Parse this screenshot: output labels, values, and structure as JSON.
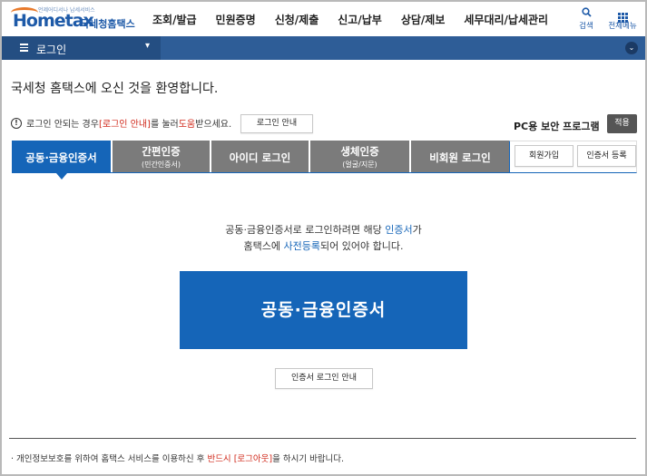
{
  "header": {
    "logo_sub": "언제어디서나 납세서비스",
    "logo_main": "Hometax",
    "logo_name": "국세청홈택스",
    "menu": [
      "조회/발급",
      "민원증명",
      "신청/제출",
      "신고/납부",
      "상담/제보",
      "세무대리/납세관리"
    ],
    "search_label": "검색",
    "all_menu_label": "전체메뉴"
  },
  "navbar": {
    "title": "로그인"
  },
  "welcome": "국세청 홈택스에 오신 것을 환영합니다.",
  "notice": {
    "prefix": "로그인 안되는 경우 ",
    "highlight": "[로그인 안내]",
    "middle": "를 눌러 ",
    "highlight2": "도움",
    "suffix": "받으세요.",
    "button": "로그인 안내"
  },
  "security": {
    "label": "PC용 보안 프로그램",
    "button": "적용"
  },
  "tabs": [
    {
      "label": "공동·금융인증서",
      "sub": ""
    },
    {
      "label": "간편인증",
      "sub": "(민간인증서)"
    },
    {
      "label": "아이디 로그인",
      "sub": ""
    },
    {
      "label": "생체인증",
      "sub": "(얼굴/지문)"
    },
    {
      "label": "비회원 로그인",
      "sub": ""
    }
  ],
  "side_buttons": {
    "join": "회원가입",
    "register": "인증서 등록"
  },
  "description": {
    "line1_a": "공동·금융인증서로 로그인하려면 해당 ",
    "line1_b": "인증서",
    "line1_c": "가",
    "line2_a": "홈택스에 ",
    "line2_b": "사전등록",
    "line2_c": "되어 있어야 합니다."
  },
  "cert_button": "공동·금융인증서",
  "cert_guide_button": "인증서 로그인 안내",
  "footer": {
    "prefix": "· 개인정보보호를 위하여 홈택스 서비스를 이용하신 후 ",
    "highlight": "반드시 [로그아웃]",
    "suffix": "을 하시기 바랍니다."
  },
  "colors": {
    "primary": "#1565b8",
    "navbar": "#2e5d97",
    "tab_inactive": "#7b7b7b",
    "alert_red": "#d0281a"
  }
}
